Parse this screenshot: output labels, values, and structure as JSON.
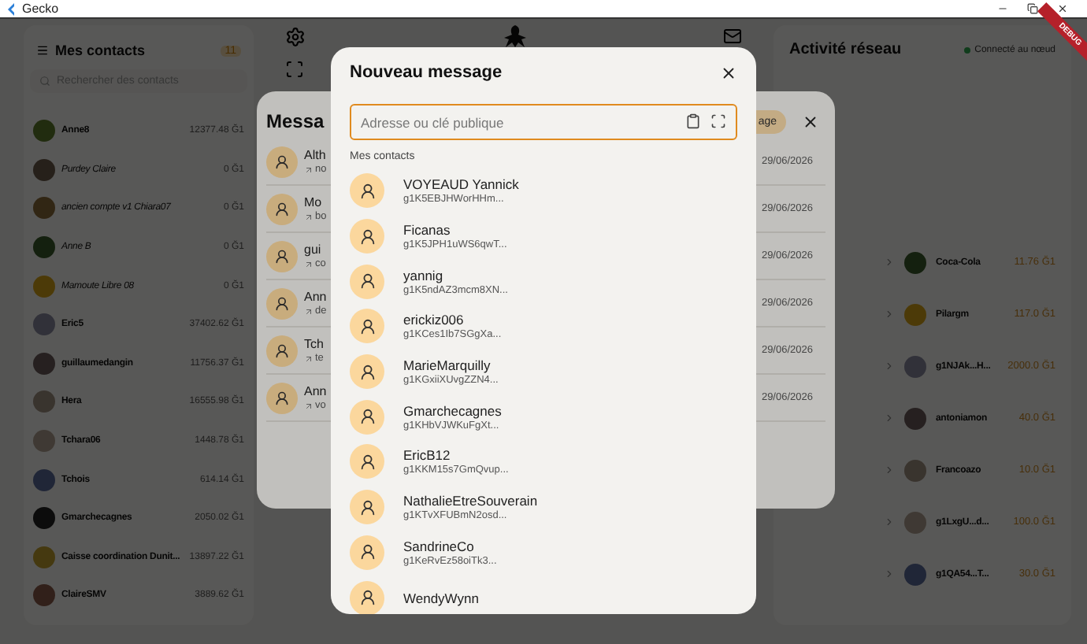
{
  "window": {
    "title": "Gecko",
    "badge": "DEBUG"
  },
  "contacts_panel": {
    "title": "Mes contacts",
    "count": "11",
    "search": {
      "placeholder": "Rechercher des contacts"
    },
    "contacts": [
      {
        "name": "Anne8",
        "balance": "12377.48 Ğ1",
        "legacy": false
      },
      {
        "name": "Purdey Claire",
        "balance": "0 Ğ1",
        "legacy": true
      },
      {
        "name": "ancien compte v1 Chiara07",
        "balance": "0 Ğ1",
        "legacy": true
      },
      {
        "name": "Anne B",
        "balance": "0 Ğ1",
        "legacy": true
      },
      {
        "name": "Mamoute Libre 08",
        "balance": "0 Ğ1",
        "legacy": true
      },
      {
        "name": "Eric5",
        "balance": "37402.62 Ğ1",
        "legacy": false
      },
      {
        "name": "guillaumedangin",
        "balance": "11756.37 Ğ1",
        "legacy": false
      },
      {
        "name": "Hera",
        "balance": "16555.98 Ğ1",
        "legacy": false
      },
      {
        "name": "Tchara06",
        "balance": "1448.78 Ğ1",
        "legacy": false
      },
      {
        "name": "Tchois",
        "balance": "614.14 Ğ1",
        "legacy": false
      },
      {
        "name": "Gmarchecagnes",
        "balance": "2050.02 Ğ1",
        "legacy": false
      },
      {
        "name": "Caisse coordination Dunit...",
        "balance": "13897.22 Ğ1",
        "legacy": false
      },
      {
        "name": "ClaireSMV",
        "balance": "3889.62 Ğ1",
        "legacy": false
      }
    ]
  },
  "messages_dialog": {
    "title": "Messa",
    "action": "age",
    "rows": [
      {
        "name": "Alth",
        "preview": "no",
        "date": "29/06/2026"
      },
      {
        "name": "Mo",
        "preview": "bo",
        "date": "29/06/2026"
      },
      {
        "name": "gui",
        "preview": "co",
        "date": "29/06/2026"
      },
      {
        "name": "Ann",
        "preview": "de",
        "date": "29/06/2026"
      },
      {
        "name": "Tch",
        "preview": "te",
        "date": "29/06/2026"
      },
      {
        "name": "Ann",
        "preview": "vo",
        "date": "29/06/2026"
      }
    ]
  },
  "network_panel": {
    "title": "Activité réseau",
    "status": "Connecté au nœud",
    "transfers": [
      {
        "to": "Coca-Cola",
        "amount": "11.76 Ğ1"
      },
      {
        "to": "Pilargm",
        "amount": "117.0 Ğ1"
      },
      {
        "to": "g1NJAk...H...",
        "amount": "2000.0 Ğ1"
      },
      {
        "to": "antoniamon",
        "amount": "40.0 Ğ1"
      },
      {
        "to": "Francoazo",
        "amount": "10.0 Ğ1"
      },
      {
        "to": "g1LxgU...d...",
        "amount": "100.0 Ğ1"
      },
      {
        "to": "g1QA54...T...",
        "amount": "30.0 Ğ1"
      }
    ]
  },
  "new_message_dialog": {
    "title": "Nouveau message",
    "address": {
      "placeholder": "Adresse ou clé publique"
    },
    "section": "Mes contacts",
    "contacts": [
      {
        "name": "VOYEAUD Yannick",
        "key": "g1K5EBJHWorHHm..."
      },
      {
        "name": "Ficanas",
        "key": "g1K5JPH1uWS6qwT..."
      },
      {
        "name": "yannig",
        "key": "g1K5ndAZ3mcm8XN..."
      },
      {
        "name": "erickiz006",
        "key": "g1KCes1Ib7SGgXa..."
      },
      {
        "name": "MarieMarquilly",
        "key": "g1KGxiiXUvgZZN4..."
      },
      {
        "name": "Gmarchecagnes",
        "key": "g1KHbVJWKuFgXt..."
      },
      {
        "name": "EricB12",
        "key": "g1KKM15s7GmQvup..."
      },
      {
        "name": "NathalieEtreSouverain",
        "key": "g1KTvXFUBmN2osd..."
      },
      {
        "name": "SandrineCo",
        "key": "g1KeRvEz58oiTk3..."
      },
      {
        "name": "WendyWynn"
      }
    ]
  }
}
